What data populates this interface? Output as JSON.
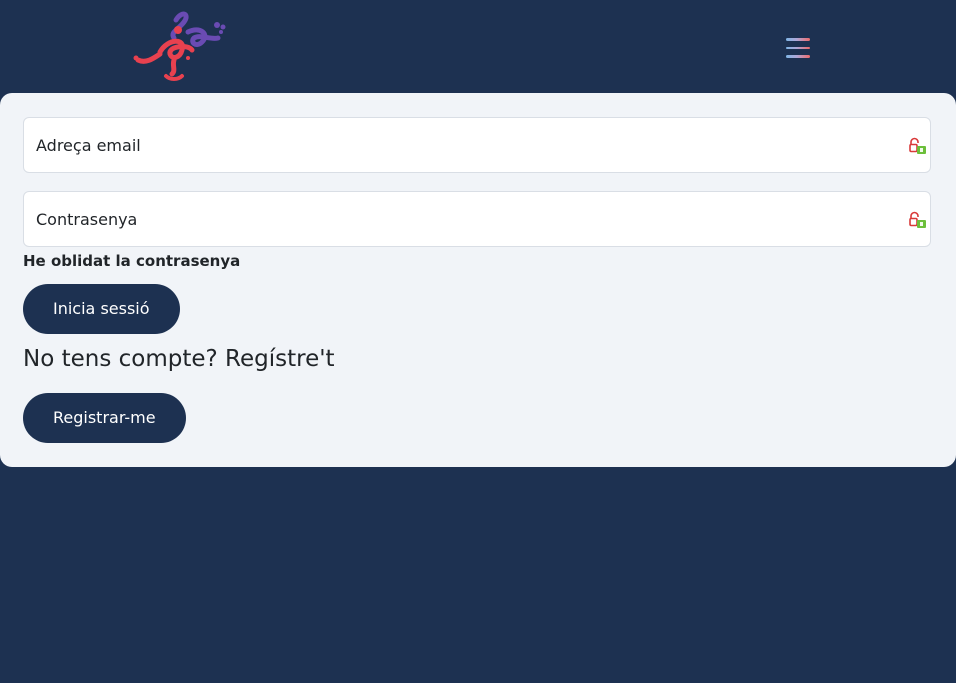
{
  "header": {
    "logo_icon": "stick-figure-logo-icon",
    "menu_icon": "hamburger-menu-icon"
  },
  "login": {
    "email_placeholder": "Adreça email",
    "password_placeholder": "Contrasenya",
    "field_icon": "password-manager-lock-icon",
    "forgot_password_label": "He oblidat la contrasenya",
    "login_button_label": "Inicia sessió"
  },
  "register": {
    "heading": "No tens compte? Regístre't",
    "register_button_label": "Registrar-me"
  },
  "colors": {
    "background": "#1d3151",
    "card": "#f1f4f8",
    "button": "#1d3151",
    "logo_red": "#e8414f",
    "logo_purple": "#6a4bb3"
  }
}
